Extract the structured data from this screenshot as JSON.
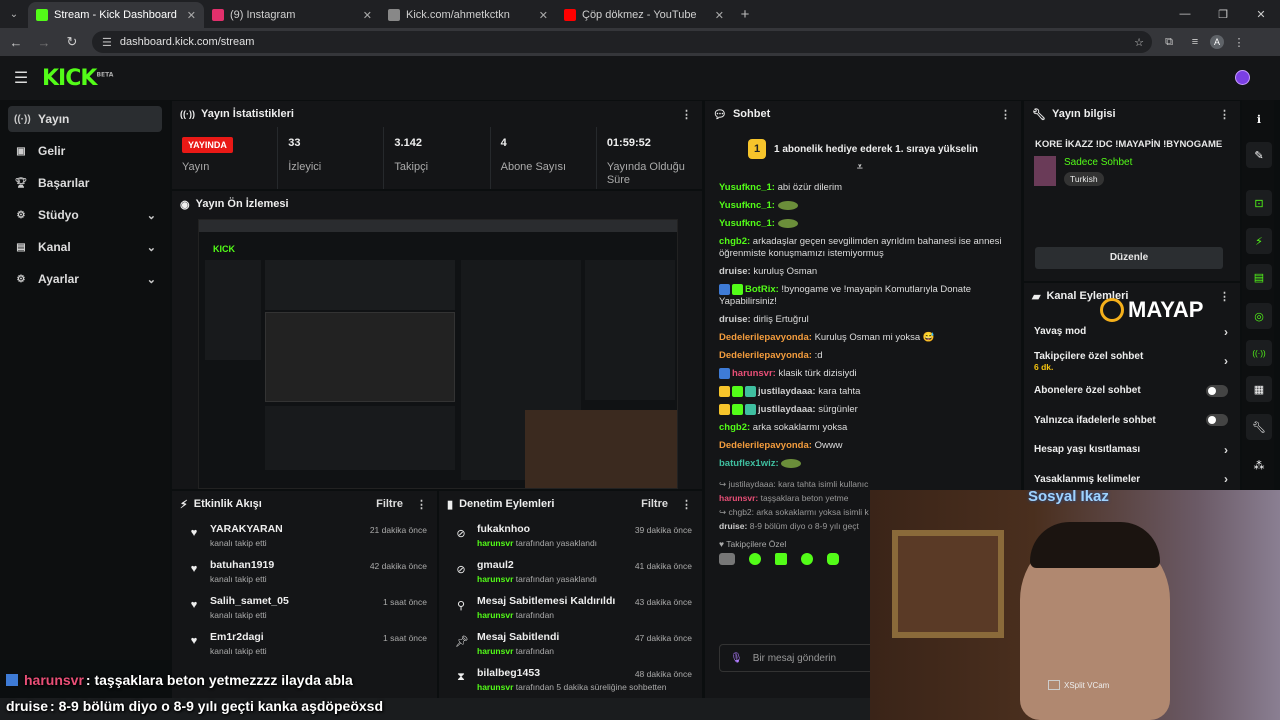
{
  "browser": {
    "tabs": [
      {
        "title": "Stream - Kick Dashboard",
        "favicon": "kick-icon",
        "color": "#53fc18",
        "active": true
      },
      {
        "title": "(9) Instagram",
        "favicon": "instagram-icon",
        "color": "#e1306c",
        "active": false
      },
      {
        "title": "Kick.com/ahmetkctkn",
        "favicon": "globe-icon",
        "color": "#888888",
        "active": false
      },
      {
        "title": "Çöp dökmez - YouTube",
        "favicon": "youtube-icon",
        "color": "#ff0000",
        "active": false
      }
    ],
    "url": "dashboard.kick.com/stream",
    "profile_initial": "A"
  },
  "kick": {
    "logo": "KICK",
    "logo_tag": "BETA"
  },
  "sidebar": {
    "items": [
      {
        "label": "Yayın",
        "icon": "broadcast-icon"
      },
      {
        "label": "Gelir",
        "icon": "revenue-icon"
      },
      {
        "label": "Başarılar",
        "icon": "trophy-icon"
      },
      {
        "label": "Stüdyo",
        "icon": "gear-icon"
      },
      {
        "label": "Kanal",
        "icon": "channel-icon"
      },
      {
        "label": "Ayarlar",
        "icon": "settings-icon"
      }
    ]
  },
  "stats": {
    "title": "Yayın İstatistikleri",
    "live_badge": "YAYINDA",
    "live_label": "Yayın",
    "viewers": "33",
    "viewers_label": "İzleyici",
    "followers": "3.142",
    "followers_label": "Takipçi",
    "subs": "4",
    "subs_label": "Abone Sayısı",
    "duration": "01:59:52",
    "duration_label": "Yayında Olduğu Süre"
  },
  "preview": {
    "title": "Yayın Ön İzlemesi"
  },
  "activity": {
    "title": "Etkinlik Akışı",
    "filter": "Filtre",
    "rows": [
      {
        "name": "YARAKYARAN",
        "sub": "kanalı takip etti",
        "time": "21 dakika önce"
      },
      {
        "name": "batuhan1919",
        "sub": "kanalı takip etti",
        "time": "42 dakika önce"
      },
      {
        "name": "Salih_samet_05",
        "sub": "kanalı takip etti",
        "time": "1 saat önce"
      },
      {
        "name": "Em1r2dagi",
        "sub": "kanalı takip etti",
        "time": "1 saat önce"
      }
    ]
  },
  "moderation": {
    "title": "Denetim Eylemleri",
    "filter": "Filtre",
    "rows": [
      {
        "name": "fukaknhoo",
        "actor": "harunsvr",
        "sub": "tarafından yasaklandı",
        "time": "39 dakika önce",
        "icon": "ban-icon"
      },
      {
        "name": "gmaul2",
        "actor": "harunsvr",
        "sub": "tarafından yasaklandı",
        "time": "41 dakika önce",
        "icon": "ban-icon"
      },
      {
        "name": "Mesaj Sabitlemesi Kaldırıldı",
        "actor": "harunsvr",
        "sub": "tarafından",
        "time": "43 dakika önce",
        "icon": "unpin-icon"
      },
      {
        "name": "Mesaj Sabitlendi",
        "actor": "harunsvr",
        "sub": "tarafından",
        "time": "47 dakika önce",
        "icon": "pin-icon"
      },
      {
        "name": "bilalbeg1453",
        "actor": "harunsvr",
        "sub": "tarafından 5 dakika süreliğine sohbetten",
        "time": "48 dakika önce",
        "icon": "timeout-icon"
      }
    ]
  },
  "chat": {
    "title": "Sohbet",
    "banner": "1 abonelik hediye ederek 1. sıraya yükselin",
    "banner_rank": "1",
    "messages": [
      {
        "user": "Yusufknc_1:",
        "text": "abi özür dilerim",
        "color": "#53fc18"
      },
      {
        "user": "Yusufknc_1:",
        "text": "",
        "color": "#53fc18",
        "emote": true
      },
      {
        "user": "Yusufknc_1:",
        "text": "",
        "color": "#53fc18",
        "emote": true
      },
      {
        "user": "chgb2:",
        "text": "arkadaşlar geçen sevgilimden ayrıldım bahanesi ise annesi öğrenmiste konuşmamızı istemiyormuş",
        "color": "#53fc18"
      },
      {
        "user": "druise:",
        "text": "kuruluş Osman",
        "color": "#cfcfcf"
      },
      {
        "user": "BotRix:",
        "text": "!bynogame ve !mayapin Komutlarıyla Donate Yapabilirsiniz!",
        "color": "#53fc18",
        "badges": [
          "#3e7bd6",
          "#53fc18"
        ]
      },
      {
        "user": "druise:",
        "text": "dirliş Ertuğrul",
        "color": "#cfcfcf"
      },
      {
        "user": "Dedelerilepavyonda:",
        "text": "Kuruluş Osman mi yoksa 😅",
        "color": "#f39c3d"
      },
      {
        "user": "Dedelerilepavyonda:",
        "text": ":d",
        "color": "#f39c3d"
      },
      {
        "user": "harunsvr:",
        "text": "klasik türk dizisiydi",
        "color": "#e94f77",
        "badges": [
          "#3e7bd6"
        ]
      },
      {
        "user": "justilaydaaa:",
        "text": "kara tahta",
        "color": "#cfcfcf",
        "badges": [
          "#f6c42b",
          "#53fc18",
          "#3fbfa0"
        ]
      },
      {
        "user": "justilaydaaa:",
        "text": "sürgünler",
        "color": "#cfcfcf",
        "badges": [
          "#f6c42b",
          "#53fc18",
          "#3fbfa0"
        ]
      },
      {
        "user": "chgb2:",
        "text": "arka sokaklarmı yoksa",
        "color": "#53fc18"
      },
      {
        "user": "Dedelerilepavyonda:",
        "text": "Owww",
        "color": "#f39c3d"
      },
      {
        "user": "batuflex1wiz:",
        "text": "",
        "color": "#3fbfa0",
        "emote": true
      }
    ],
    "reply_hints": [
      {
        "text": "justilaydaaa: kara tahta isimli kullanıc"
      },
      {
        "user": "harunsvr:",
        "text": "taşşaklara beton yetme"
      },
      {
        "text": "chgb2: arka sokaklarmı yoksa isimli k"
      },
      {
        "user": "druise:",
        "text": "8-9 bölüm diyo o 8-9 yılı geçt"
      }
    ],
    "followers_only_label": "Takipçilere Özel",
    "placeholder": "Bir mesaj gönderin"
  },
  "stream_info": {
    "title": "Yayın bilgisi",
    "stream_title": "KORE İKAZZ !DC !MAYAPİN !BYNOGAME",
    "category": "Sadece Sohbet",
    "tag": "Turkish",
    "edit_button": "Düzenle"
  },
  "channel_actions": {
    "title": "Kanal Eylemleri",
    "sponsor": "MAYAP",
    "items": [
      {
        "label": "Yavaş mod",
        "control": "chevron"
      },
      {
        "label": "Takipçilere özel sohbet",
        "sub": "6 dk.",
        "control": "chevron"
      },
      {
        "label": "Abonelere özel sohbet",
        "control": "toggle"
      },
      {
        "label": "Yalnızca ifadelerle sohbet",
        "control": "toggle"
      },
      {
        "label": "Hesap yaşı kısıtlaması",
        "control": "chevron"
      },
      {
        "label": "Yasaklanmış kelimeler",
        "control": "chevron"
      }
    ]
  },
  "overlay": {
    "cam_title": "Sosyal İkaz",
    "cam_watermark": "XSplit VCam",
    "line1_user": "harunsvr",
    "line1_text": ": taşşaklara beton yetmezzzz ilayda abla",
    "line2_user": "druise",
    "line2_text": ": 8-9 bölüm diyo o 8-9 yılı geçti kanka aşdöpeöxsd"
  },
  "colors": {
    "accent": "#53fc18",
    "live": "#e91916",
    "panel": "#141517",
    "bg": "#0b0e0f"
  }
}
